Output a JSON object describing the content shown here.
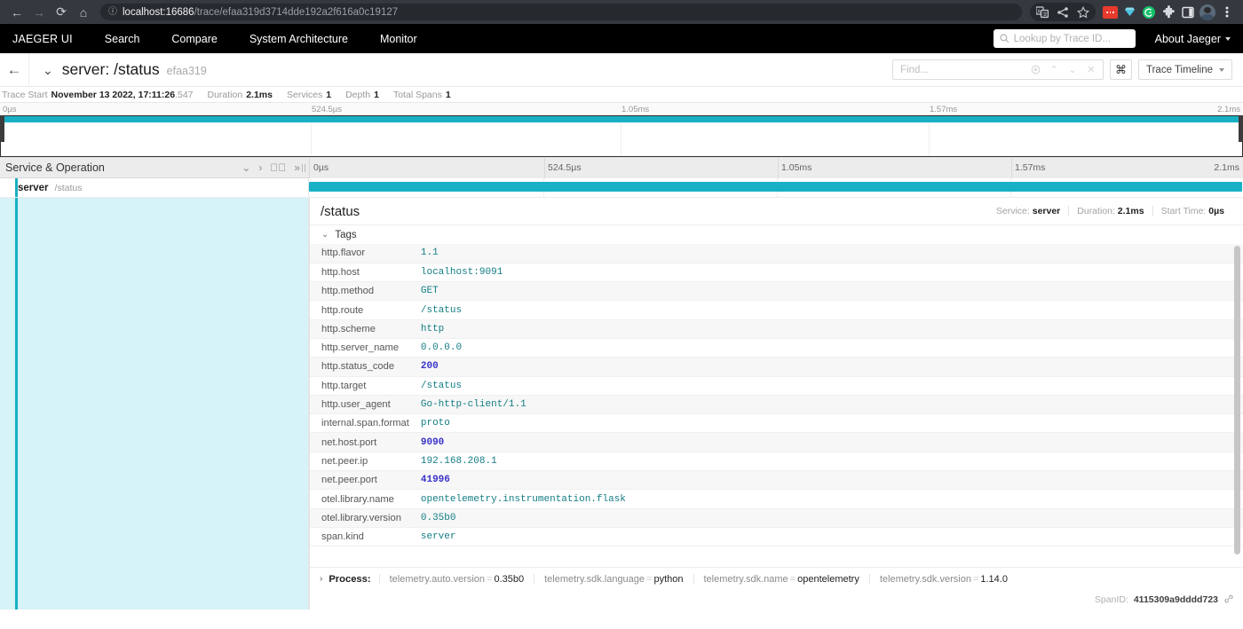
{
  "browser": {
    "url_host": "localhost:16686",
    "url_path": "/trace/efaa319d3714dde192a2f616a0c19127",
    "back_icon": "back-arrow-icon",
    "forward_icon": "forward-arrow-icon",
    "reload_icon": "reload-icon",
    "home_icon": "home-icon",
    "info_icon": "site-info-icon",
    "translate_icon": "translate-icon",
    "share_icon": "share-icon",
    "bookmark_icon": "bookmark-star-icon",
    "menu_icon": "browser-menu-icon"
  },
  "nav": {
    "brand": "JAEGER UI",
    "links": [
      {
        "label": "Search"
      },
      {
        "label": "Compare"
      },
      {
        "label": "System Architecture"
      },
      {
        "label": "Monitor"
      }
    ],
    "lookup_placeholder": "Lookup by Trace ID...",
    "about_label": "About Jaeger"
  },
  "trace_header": {
    "title": "server: /status",
    "trace_id": "efaa319",
    "find_placeholder": "Find...",
    "kbd_label": "⌘",
    "view_label": "Trace Timeline"
  },
  "summary": [
    {
      "label": "Trace Start",
      "value": "November 13 2022, 17:11:26",
      "fraction": ".547"
    },
    {
      "label": "Duration",
      "value": "2.1ms"
    },
    {
      "label": "Services",
      "value": "1"
    },
    {
      "label": "Depth",
      "value": "1"
    },
    {
      "label": "Total Spans",
      "value": "1"
    }
  ],
  "minimap": {
    "ticks": [
      "0µs",
      "524.5µs",
      "1.05ms",
      "1.57ms",
      "2.1ms"
    ],
    "bar_color": "#19b0c4"
  },
  "timeline": {
    "column_header": "Service & Operation",
    "collapse_icons": [
      "chevron-down-icon",
      "chevron-right-icon",
      "double-chevron-down-icon",
      "double-chevron-right-icon"
    ],
    "ticks": [
      "0µs",
      "524.5µs",
      "1.05ms",
      "1.57ms",
      "2.1ms"
    ],
    "rows": [
      {
        "service": "server",
        "operation": "/status",
        "bar_start_pct": 0,
        "bar_width_pct": 100,
        "color": "#17b0c4"
      }
    ]
  },
  "span_detail": {
    "operation": "/status",
    "meta": [
      {
        "key": "Service:",
        "value": "server"
      },
      {
        "key": "Duration:",
        "value": "2.1ms"
      },
      {
        "key": "Start Time:",
        "value": "0µs"
      }
    ],
    "tags_label": "Tags",
    "tags": [
      {
        "key": "http.flavor",
        "value": "1.1",
        "numeric": false
      },
      {
        "key": "http.host",
        "value": "localhost:9091",
        "numeric": false
      },
      {
        "key": "http.method",
        "value": "GET",
        "numeric": false
      },
      {
        "key": "http.route",
        "value": "/status",
        "numeric": false
      },
      {
        "key": "http.scheme",
        "value": "http",
        "numeric": false
      },
      {
        "key": "http.server_name",
        "value": "0.0.0.0",
        "numeric": false
      },
      {
        "key": "http.status_code",
        "value": "200",
        "numeric": true
      },
      {
        "key": "http.target",
        "value": "/status",
        "numeric": false
      },
      {
        "key": "http.user_agent",
        "value": "Go-http-client/1.1",
        "numeric": false
      },
      {
        "key": "internal.span.format",
        "value": "proto",
        "numeric": false
      },
      {
        "key": "net.host.port",
        "value": "9090",
        "numeric": true
      },
      {
        "key": "net.peer.ip",
        "value": "192.168.208.1",
        "numeric": false
      },
      {
        "key": "net.peer.port",
        "value": "41996",
        "numeric": true
      },
      {
        "key": "otel.library.name",
        "value": "opentelemetry.instrumentation.flask",
        "numeric": false
      },
      {
        "key": "otel.library.version",
        "value": "0.35b0",
        "numeric": false
      },
      {
        "key": "span.kind",
        "value": "server",
        "numeric": false
      }
    ],
    "process_label": "Process:",
    "process_tags": [
      {
        "key": "telemetry.auto.version",
        "value": "0.35b0"
      },
      {
        "key": "telemetry.sdk.language",
        "value": "python"
      },
      {
        "key": "telemetry.sdk.name",
        "value": "opentelemetry"
      },
      {
        "key": "telemetry.sdk.version",
        "value": "1.14.0"
      }
    ],
    "span_id_label": "SpanID:",
    "span_id": "4115309a9dddd723",
    "link_icon": "link-icon"
  }
}
